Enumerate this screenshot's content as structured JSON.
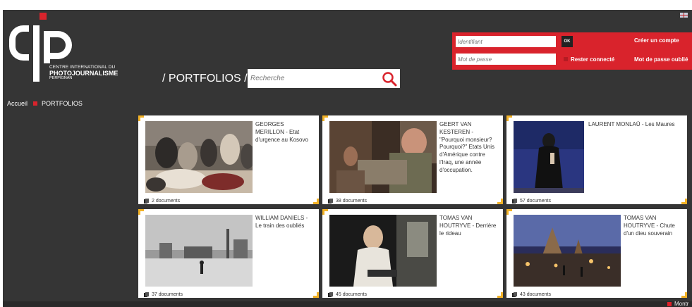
{
  "logo": {
    "line1": "CENTRE INTERNATIONAL DU",
    "line2": "PHOTOJOURNALISME",
    "line3": "PERPIGNAN"
  },
  "page_title": "/ PORTFOLIOS /",
  "search": {
    "placeholder": "Recherche"
  },
  "login": {
    "identifiant_placeholder": "Identifiant",
    "password_placeholder": "Mot de passe",
    "ok_label": "OK",
    "create_account": "Créer un compte",
    "remember": "Rester connecté",
    "forgot": "Mot de passe oublié"
  },
  "breadcrumb": {
    "home": "Accueil",
    "current": "PORTFOLIOS"
  },
  "portfolios": [
    {
      "caption": "GEORGES MERILLON - Etat d'urgence au Kosovo",
      "docs": "2 documents"
    },
    {
      "caption": "GEERT VAN KESTEREN - \"Pourquoi monsieur? Pourquoi?\" Etats Unis d'Amérique contre l'Iraq, une année d'occupation.",
      "docs": "38 documents"
    },
    {
      "caption": "LAURENT MONLAÜ - Les Maures",
      "docs": "57 documents"
    },
    {
      "caption": "WILLIAM DANIELS - Le train des oubliés",
      "docs": "37 documents"
    },
    {
      "caption": "TOMAS VAN HOUTRYVE - Derrière le rideau",
      "docs": "45 documents"
    },
    {
      "caption": "TOMAS VAN HOUTRYVE - Chute d'un dieu souverain",
      "docs": "43 documents"
    }
  ],
  "footer": {
    "label": "Montr"
  },
  "colors": {
    "brand_red": "#d9232c",
    "background": "#353535",
    "corner_accent": "#f2b227"
  }
}
